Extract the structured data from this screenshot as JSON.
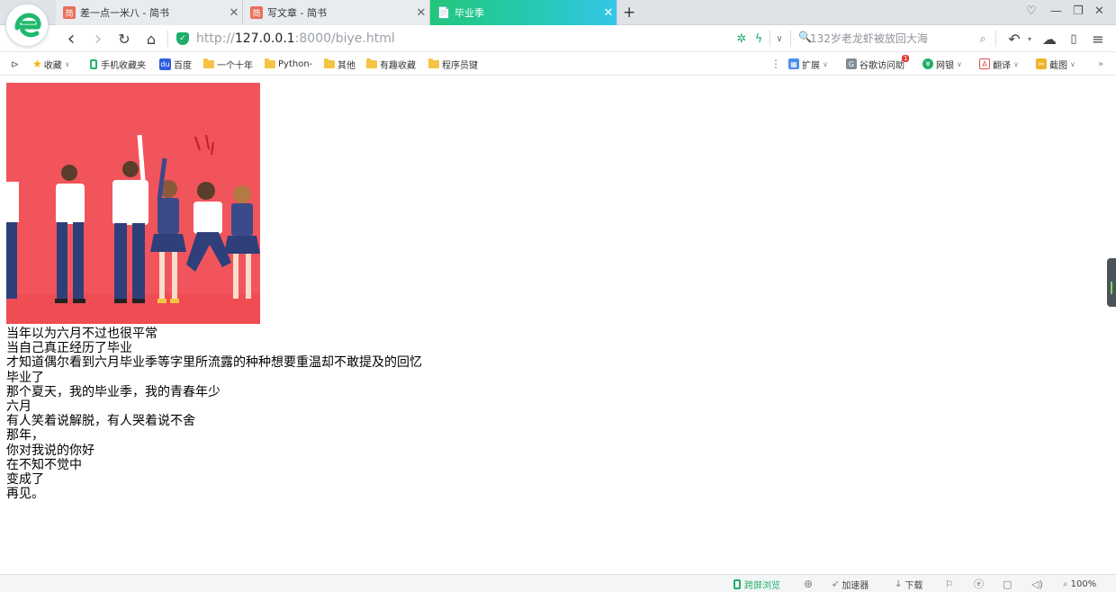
{
  "tabs": [
    {
      "favicon": "简",
      "title": "差一点一米八 - 简书",
      "close": "✕"
    },
    {
      "favicon": "简",
      "title": "写文章 - 简书",
      "close": "✕"
    },
    {
      "favicon": "📄",
      "title": "毕业季",
      "close": "✕"
    }
  ],
  "new_tab": "+",
  "window_controls": {
    "skin": "♡",
    "minimize": "—",
    "restore": "❐",
    "close": "✕"
  },
  "nav": {
    "back": "‹",
    "forward": "›",
    "reload": "↻",
    "home": "⌂"
  },
  "address": {
    "protocol": "http://",
    "host": "127.0.0.1",
    "path": ":8000/biye.html"
  },
  "search": {
    "placeholder": "132岁老龙虾被放回大海"
  },
  "bookmarks": [
    {
      "label": "收藏",
      "icon": "star-icon"
    },
    {
      "label": "手机收藏夹",
      "icon": "phone-icon"
    },
    {
      "label": "百度",
      "icon": "baidu-paw-icon"
    },
    {
      "label": "一个十年",
      "icon": "folder-icon"
    },
    {
      "label": "Python-",
      "icon": "folder-icon"
    },
    {
      "label": "其他",
      "icon": "folder-icon"
    },
    {
      "label": "有趣收藏",
      "icon": "folder-icon"
    },
    {
      "label": "程序员键",
      "icon": "folder-icon"
    }
  ],
  "extensions": [
    {
      "label": "扩展"
    },
    {
      "label": "谷歌访问助",
      "badge": "1"
    },
    {
      "label": "网银"
    },
    {
      "label": "翻译"
    },
    {
      "label": "截图"
    }
  ],
  "page": {
    "image_alt": "毕业季插画",
    "lines": [
      "当年以为六月不过也很平常",
      "当自己真正经历了毕业",
      "才知道偶尔看到六月毕业季等字里所流露的种种想要重温却不敢提及的回忆",
      "毕业了",
      "那个夏天，我的毕业季，我的青春年少",
      "六月",
      "有人笑着说解脱，有人哭着说不舍",
      "那年，",
      "你对我说的你好",
      "在不知不觉中",
      "变成了",
      "再见。"
    ]
  },
  "status": {
    "cross_screen": "跨屏浏览",
    "accelerator": "加速器",
    "download": "下载",
    "zoom": "100%"
  },
  "colors": {
    "accent_green": "#1fae6a",
    "hero_bg": "#f2545b"
  }
}
